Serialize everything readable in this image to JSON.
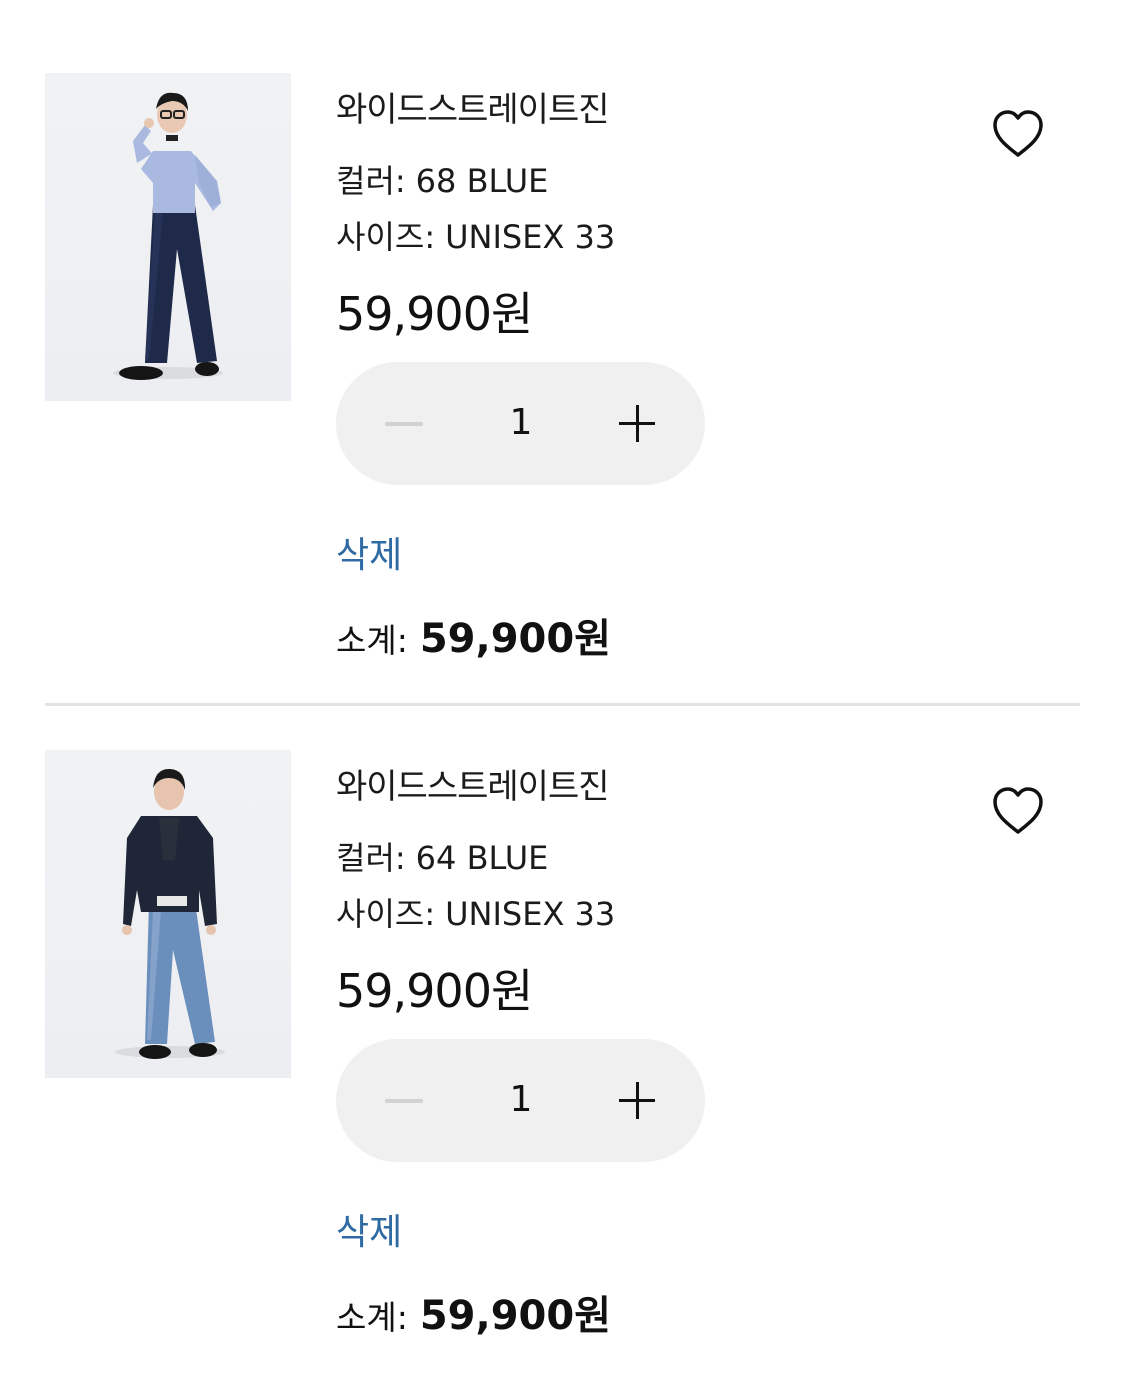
{
  "cart_items": [
    {
      "name": "와이드스트레이트진",
      "color_label": "컬러:",
      "color_value": "68 BLUE",
      "size_label": "사이즈:",
      "size_value": "UNISEX 33",
      "price": "59,900원",
      "quantity": "1",
      "delete_label": "삭제",
      "subtotal_label": "소계:",
      "subtotal_value": "59,900원",
      "wishlist_icon": "heart-outline-icon",
      "photo": "model-light-blue-shirt-navy-jeans"
    },
    {
      "name": "와이드스트레이트진",
      "color_label": "컬러:",
      "color_value": "64 BLUE",
      "size_label": "사이즈:",
      "size_value": "UNISEX 33",
      "price": "59,900원",
      "quantity": "1",
      "delete_label": "삭제",
      "subtotal_label": "소계:",
      "subtotal_value": "59,900원",
      "wishlist_icon": "heart-outline-icon",
      "photo": "model-navy-jacket-blue-jeans"
    }
  ],
  "colors": {
    "delete_link": "#2f6aa3",
    "stepper_bg": "#f0f0f0",
    "divider": "#e2e2e2"
  }
}
